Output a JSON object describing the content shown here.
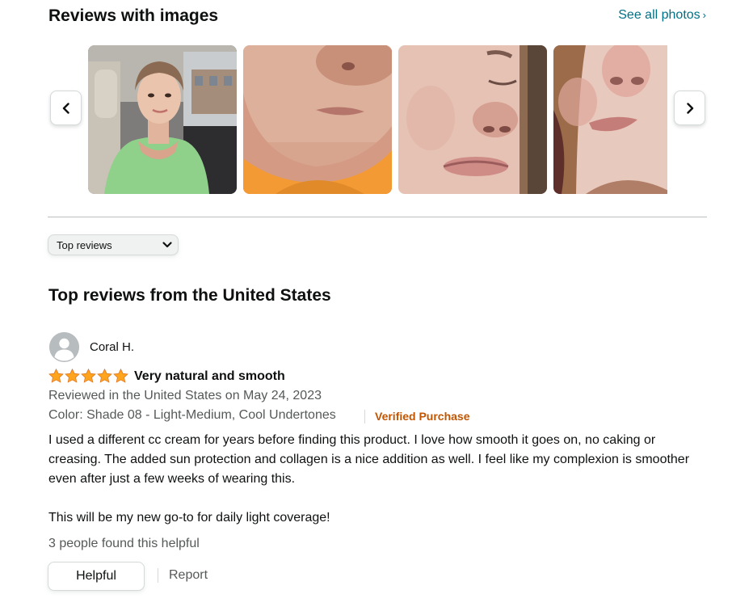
{
  "images_section": {
    "title": "Reviews with images",
    "see_all_label": "See all photos",
    "see_all_chevron": "›",
    "prev_icon": "chevron-left-icon",
    "next_icon": "chevron-right-icon",
    "thumbnail_count": 4
  },
  "sort": {
    "selected": "Top reviews",
    "icon": "chevron-down-icon"
  },
  "reviews_heading": "Top reviews from the United States",
  "review": {
    "author": "Coral H.",
    "rating": 5,
    "title": "Very natural and smooth",
    "date": "Reviewed in the United States on May 24, 2023",
    "variant": "Color: Shade 08 - Light-Medium, Cool Undertones",
    "verified_label": "Verified Purchase",
    "body_paragraphs": [
      "I used a different cc cream for years before finding this product. I love how smooth it goes on, no caking or creasing. The added sun protection and collagen is a nice addition as well. I feel like my complexion is smoother even after just a few weeks of wearing this.",
      "This will be my new go-to for daily light coverage!"
    ],
    "helpful_count_text": "3 people found this helpful",
    "helpful_button": "Helpful",
    "report_label": "Report"
  },
  "colors": {
    "link": "#007185",
    "verified": "#c45500",
    "star": "#ffa41c",
    "muted_text": "#565959"
  }
}
